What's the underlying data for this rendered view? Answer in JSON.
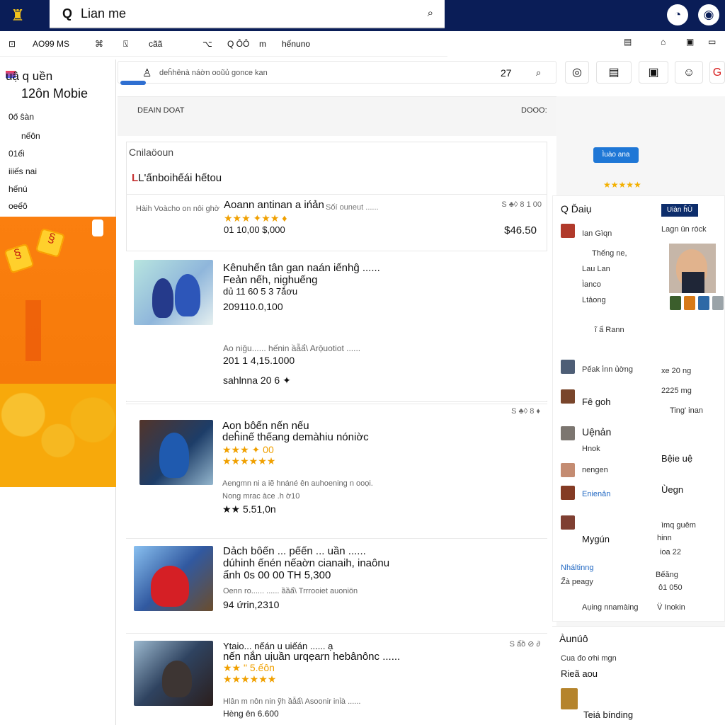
{
  "header": {
    "search_label": "Q",
    "search_text": "Lian me",
    "top_icons": [
      "profile-icon",
      "settings-icon"
    ]
  },
  "nav": {
    "items": [
      "⊡",
      "AO99 MS",
      "⌘",
      "⍂",
      "cãã",
      "⌥",
      "Q ÔÔ",
      "m",
      "hếnuno"
    ],
    "right_icons": [
      "▤",
      "⌂",
      "▣",
      "▭"
    ]
  },
  "sidebar": {
    "title": "uậ q uền",
    "subtitle": "12ôn Mobie",
    "items": [
      "0ő ŝàn",
      "nếôn",
      "01ếi",
      "iiiếs nai",
      "hếnú",
      "oeếô"
    ]
  },
  "main": {
    "search_placeholder": "deĥhênà náờn ooũủ gonce kan",
    "search_number": "27",
    "header_left": "DEAIN DOAT",
    "header_right": "DOOO:",
    "panel_title": "Cnilaöoun",
    "subtitle": "L'ấnboihếái hếtou",
    "card1": {
      "label": "Hàih Voàcho on nôi ghờ",
      "title": "Aoann antinan a ińản",
      "stars": "★★★ ✦★★ ♦",
      "number": "01 10,00 $,000",
      "small": "Sốí ouneut ......",
      "tiny": "S ♣◊ 8 1 00",
      "price": "$46.50"
    },
    "products": [
      {
        "title": "Kênuhến tân gan naán iếnhĝ ......",
        "line2": "Feản nếh, nighuếng",
        "line3": "dủ 11 60 5 3 7ắơu",
        "number": "209110.0,100",
        "line4": "Ao niğu...... hếnin ầẫẩ\\ Arộuotiot ......",
        "number2": "201 1 4,15.1000",
        "stars2": "sahlnna 20 6 ✦"
      },
      {
        "title": "Aon bôến nến nếu",
        "line2": "deĥinế thếang demàhiu nóniờc",
        "stars": "★★★ ✦ 00",
        "stars2": "★★★★★★",
        "line3": "Aengmn ni a iẽ hnáné ên auhoening n ooọi.",
        "line4": "Nong mrac àce .h ờ10",
        "number": "★★ 5.51,0n",
        "price": "S ♣◊ 8 ♦"
      },
      {
        "title": "Dảch bôến ... pếến ... uần ......",
        "line2": "dúhinh ếnén nếaờn cianaih, inaônu",
        "line3": "ẩnh 0s 00 00 TH 5,300",
        "line4": "Oenn ro...... ...... ầầẩ\\ Trrrooiet auoniön",
        "number": "94 ứrin,2310"
      },
      {
        "title": "Ytaio... nếán u uiếán ...... ạ",
        "line2": "nến nắn uịuần urqẹarn hebânônc ......",
        "stars": "★★ \" 5.ếôn",
        "stars2": "★★★★★★",
        "line4": "Hlân m nôn nin ỹh ầẫẩ\\ Asoonir inỉà ......",
        "number": "Hèng ên 6.600",
        "price": "S ẩồ ⊘ ∂"
      }
    ]
  },
  "right": {
    "button": "Ìuào ana",
    "stars": "★★★★★",
    "title": "Q Ďaiụ",
    "badge": "Uiàn ĥÙ",
    "subtitle": "Lagn ûn ròck",
    "rows": [
      {
        "text": "Ian Gìqn"
      },
      {
        "text": "Thếng ne,"
      },
      {
        "text": "Lau Lan"
      },
      {
        "text": "Ìanco"
      },
      {
        "text": "Ltảong"
      },
      {
        "text": "ĩ ẩ Rann"
      },
      {
        "text": "Pếak ì̇nn ủờng"
      },
      {
        "text": "Fê goh"
      },
      {
        "text": "Uệnản"
      },
      {
        "text": "Hnok"
      },
      {
        "text": "nengen"
      },
      {
        "text": "Enienản"
      },
      {
        "text": "Mygún"
      },
      {
        "text": "Nháltinng"
      },
      {
        "text": "Z̃à peagy"
      },
      {
        "text": "Aụing nnamàing"
      }
    ],
    "side_values": [
      "xe 20 ng",
      "2225 mg",
      "Ting' inan",
      "Bệie uệ",
      "Ùegn",
      "ìmq guêm",
      "hinn",
      "ioa 22",
      "Bếăng",
      "ô1 050",
      "V̈ Inokin"
    ],
    "footer_title": "Àunúô",
    "footer_line": "Cua đo ơhi mgn",
    "footer_sub": "Rieã aou",
    "footer_bottom": "Teiá bínding"
  }
}
